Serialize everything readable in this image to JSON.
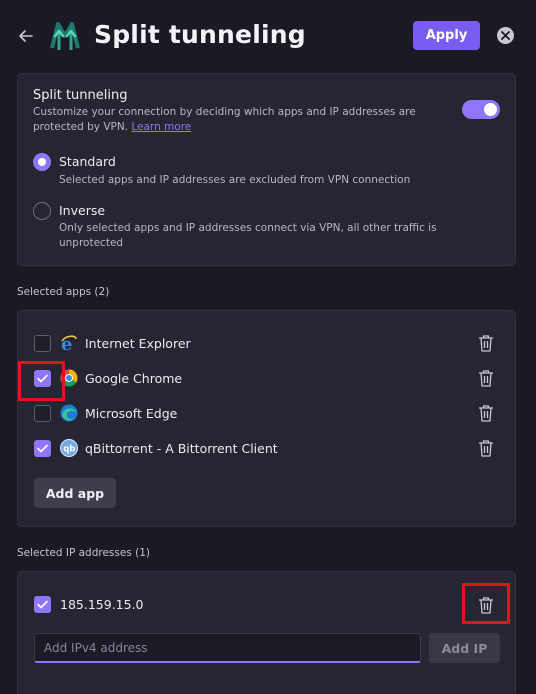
{
  "header": {
    "title": "Split tunneling",
    "apply_label": "Apply"
  },
  "split_tunneling": {
    "title": "Split tunneling",
    "description": "Customize your connection by deciding which apps and IP addresses are protected by VPN.",
    "learn_more": "Learn more",
    "enabled": true,
    "options": [
      {
        "label": "Standard",
        "description": "Selected apps and IP addresses are excluded from VPN connection",
        "selected": true
      },
      {
        "label": "Inverse",
        "description": "Only selected apps and IP addresses connect via VPN, all other traffic is unprotected",
        "selected": false
      }
    ]
  },
  "apps_section": {
    "label": "Selected apps (2)",
    "items": [
      {
        "name": "Internet Explorer",
        "checked": false,
        "icon": "internet-explorer-icon"
      },
      {
        "name": "Google Chrome",
        "checked": true,
        "icon": "google-chrome-icon"
      },
      {
        "name": "Microsoft Edge",
        "checked": false,
        "icon": "microsoft-edge-icon"
      },
      {
        "name": "qBittorrent - A Bittorrent Client",
        "checked": true,
        "icon": "qbittorrent-icon"
      }
    ],
    "add_app_label": "Add app"
  },
  "ip_section": {
    "label": "Selected IP addresses (1)",
    "items": [
      {
        "address": "185.159.15.0",
        "checked": true
      }
    ],
    "input_placeholder": "Add IPv4 address",
    "add_ip_label": "Add IP"
  },
  "qb_icon_text": "qb",
  "colors": {
    "accent": "#8f75f7",
    "apply_button": "#7b5cf0",
    "highlight": "#e5121e",
    "background": "#1b1a24",
    "card": "#262531"
  }
}
